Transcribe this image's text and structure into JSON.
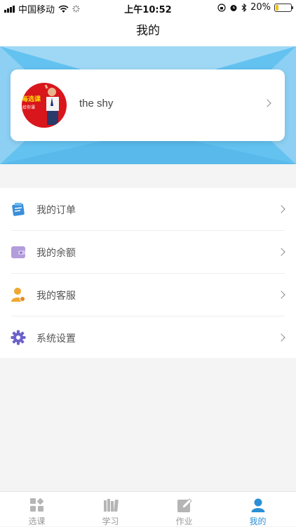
{
  "status_bar": {
    "carrier": "中国移动",
    "time": "上午10:52",
    "battery": "20%",
    "battery_level": 0.2
  },
  "nav": {
    "title": "我的"
  },
  "profile": {
    "username": "the shy",
    "avatar_text": "每选课",
    "avatar_subtext": "给你课"
  },
  "menu": {
    "items": [
      {
        "label": "我的订单",
        "icon": "order-icon"
      },
      {
        "label": "我的余额",
        "icon": "wallet-icon"
      },
      {
        "label": "我的客服",
        "icon": "customer-service-icon"
      },
      {
        "label": "系统设置",
        "icon": "gear-icon"
      }
    ]
  },
  "tabs": [
    {
      "label": "选课",
      "icon": "course-select-icon",
      "active": false
    },
    {
      "label": "学习",
      "icon": "books-icon",
      "active": false
    },
    {
      "label": "作业",
      "icon": "homework-edit-icon",
      "active": false
    },
    {
      "label": "我的",
      "icon": "person-icon",
      "active": true
    }
  ],
  "colors": {
    "accent": "#2a8fd6",
    "banner": "#63c2f0"
  }
}
